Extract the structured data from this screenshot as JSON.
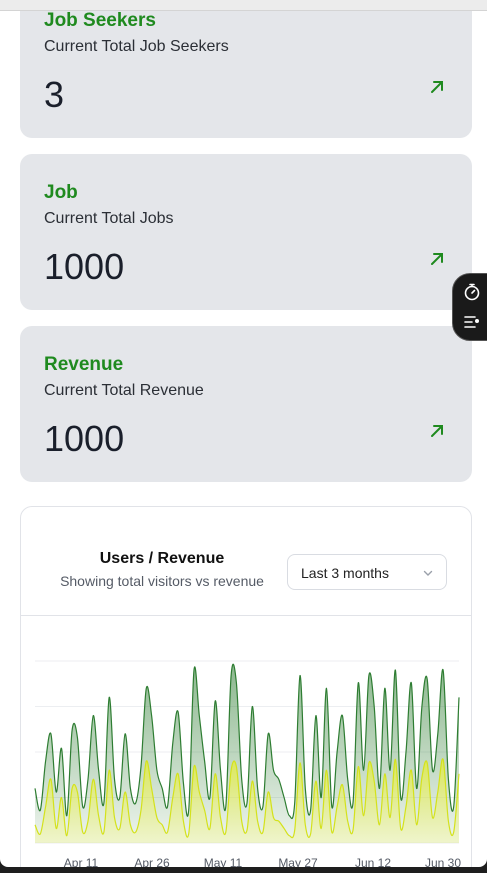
{
  "cards": [
    {
      "title": "Job Seekers",
      "subtitle": "Current Total Job Seekers",
      "value": "3"
    },
    {
      "title": "Job",
      "subtitle": "Current Total Jobs",
      "value": "1000"
    },
    {
      "title": "Revenue",
      "subtitle": "Current Total Revenue",
      "value": "1000"
    }
  ],
  "chart_card": {
    "title": "Users / Revenue",
    "subtitle": "Showing total visitors vs revenue",
    "range_select": "Last 3 months"
  },
  "colors": {
    "accent_green": "#1f8a1f",
    "visitors_stroke": "#2e7d32",
    "revenue_stroke": "#d4e21b"
  },
  "icons": {
    "card_link": "arrow-up-right-icon",
    "dock_timer": "stopwatch-icon",
    "dock_list": "list-settings-icon",
    "select": "chevron-down-icon"
  },
  "chart_data": {
    "type": "area",
    "title": "Users / Revenue",
    "subtitle": "Showing total visitors vs revenue",
    "x_tick_labels": [
      "Apr 11",
      "Apr 26",
      "May 11",
      "May 27",
      "Jun 12",
      "Jun 30"
    ],
    "grid": true,
    "ylim": [
      0,
      100
    ],
    "series": [
      {
        "name": "",
        "color": "#2e7d32",
        "values": [
          30,
          18,
          45,
          60,
          28,
          52,
          15,
          62,
          58,
          20,
          35,
          70,
          40,
          22,
          80,
          35,
          25,
          60,
          30,
          22,
          42,
          85,
          70,
          40,
          30,
          20,
          55,
          72,
          33,
          18,
          95,
          70,
          45,
          25,
          78,
          40,
          20,
          92,
          88,
          35,
          22,
          75,
          30,
          20,
          60,
          40,
          35,
          25,
          15,
          22,
          92,
          30,
          18,
          70,
          25,
          85,
          20,
          50,
          70,
          35,
          22,
          88,
          40,
          92,
          75,
          30,
          85,
          40,
          95,
          25,
          50,
          88,
          30,
          75,
          90,
          40,
          60,
          95,
          35,
          20,
          80
        ]
      },
      {
        "name": "",
        "color": "#d4e21b",
        "values": [
          10,
          5,
          20,
          35,
          8,
          25,
          4,
          30,
          28,
          6,
          12,
          35,
          15,
          6,
          40,
          14,
          8,
          28,
          10,
          6,
          18,
          45,
          30,
          14,
          10,
          6,
          25,
          38,
          12,
          5,
          42,
          28,
          18,
          8,
          38,
          14,
          6,
          40,
          42,
          12,
          7,
          34,
          12,
          6,
          28,
          14,
          12,
          8,
          4,
          7,
          44,
          10,
          5,
          34,
          8,
          40,
          6,
          20,
          32,
          12,
          7,
          42,
          15,
          44,
          34,
          10,
          38,
          14,
          46,
          8,
          20,
          40,
          10,
          36,
          44,
          14,
          28,
          46,
          12,
          6,
          38
        ]
      }
    ]
  }
}
